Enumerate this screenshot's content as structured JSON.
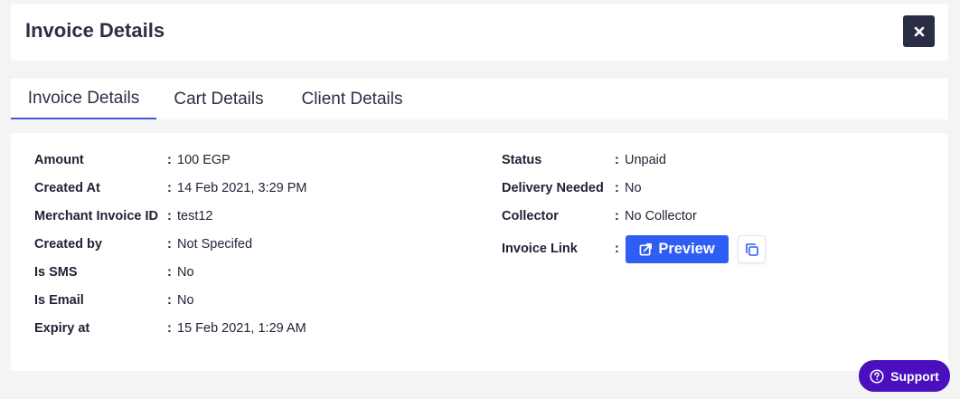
{
  "header": {
    "title": "Invoice Details"
  },
  "tabs": [
    {
      "label": "Invoice Details",
      "active": true
    },
    {
      "label": "Cart Details",
      "active": false
    },
    {
      "label": "Client Details",
      "active": false
    }
  ],
  "left_fields": [
    {
      "label": "Amount",
      "value": "100 EGP"
    },
    {
      "label": "Created At",
      "value": "14 Feb 2021, 3:29 PM"
    },
    {
      "label": "Merchant Invoice ID",
      "value": "test12"
    },
    {
      "label": "Created by",
      "value": "Not Specifed"
    },
    {
      "label": "Is SMS",
      "value": "No"
    },
    {
      "label": "Is Email",
      "value": "No"
    },
    {
      "label": "Expiry at",
      "value": "15 Feb 2021, 1:29 AM"
    }
  ],
  "right_fields": [
    {
      "label": "Status",
      "value": "Unpaid"
    },
    {
      "label": "Delivery Needed",
      "value": "No"
    },
    {
      "label": "Collector",
      "value": "No Collector"
    },
    {
      "label": "Invoice Link",
      "value": ""
    }
  ],
  "separator": ":",
  "invoice_link": {
    "preview_label": "Preview",
    "icons": [
      "external-link-icon",
      "copy-icon"
    ]
  },
  "support": {
    "label": "Support",
    "icon": "help-circle-icon"
  },
  "colors": {
    "accent": "#2f5ef5",
    "tab_underline": "#3b5bdb",
    "close_bg": "#2a2d44",
    "support_bg": "#4b0fbf",
    "page_bg": "#f4f4f4"
  }
}
